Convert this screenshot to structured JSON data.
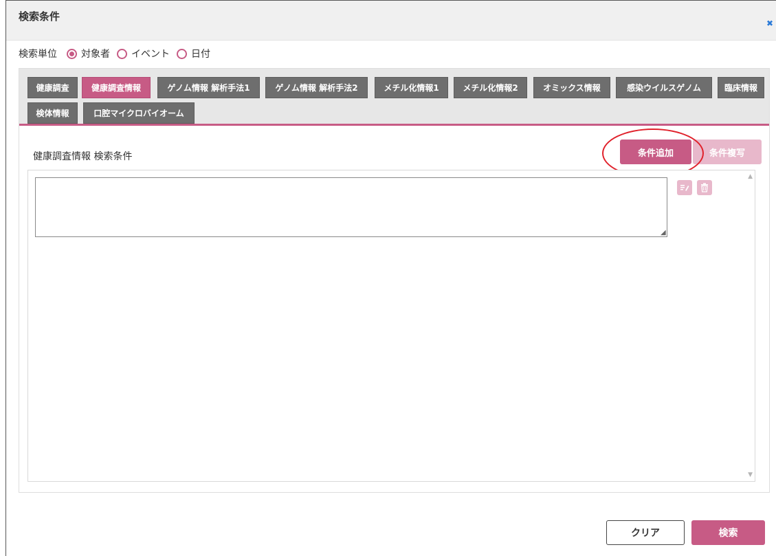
{
  "dialog": {
    "title": "検索条件"
  },
  "search_unit": {
    "label": "検索単位",
    "options": [
      {
        "label": "対象者",
        "checked": true
      },
      {
        "label": "イベント",
        "checked": false
      },
      {
        "label": "日付",
        "checked": false
      }
    ]
  },
  "tabs": [
    {
      "label": "健康調査",
      "active": false
    },
    {
      "label": "健康調査情報",
      "active": true
    },
    {
      "label": "ゲノム情報 解析手法1",
      "active": false
    },
    {
      "label": "ゲノム情報 解析手法2",
      "active": false
    },
    {
      "label": "メチル化情報1",
      "active": false
    },
    {
      "label": "メチル化情報2",
      "active": false
    },
    {
      "label": "オミックス情報",
      "active": false
    },
    {
      "label": "感染ウイルスゲノム",
      "active": false
    },
    {
      "label": "臨床情報",
      "active": false
    },
    {
      "label": "検体情報",
      "active": false
    },
    {
      "label": "口腔マイクロバイオーム",
      "active": false
    }
  ],
  "section": {
    "title": "健康調査情報 検索条件",
    "add_button": "条件追加",
    "copy_button": "条件複写",
    "condition_text": ""
  },
  "footer": {
    "clear_button": "クリア",
    "search_button": "検索"
  },
  "colors": {
    "accent": "#c75b85",
    "accent_disabled": "#e8b8cb",
    "tab_inactive": "#6e6e6e",
    "highlight_ring": "#e0202a",
    "close_icon": "#2a7ad8"
  }
}
